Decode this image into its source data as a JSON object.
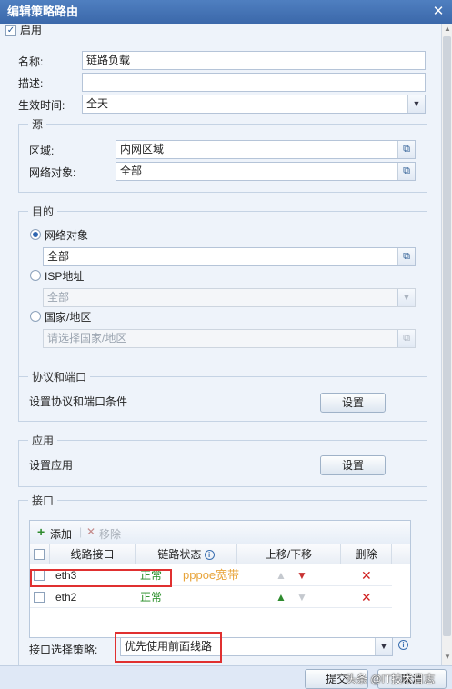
{
  "window": {
    "title": "编辑策略路由",
    "close_glyph": "✕"
  },
  "enable": {
    "label": "启用",
    "checked": true
  },
  "fields": {
    "name_label": "名称:",
    "name_value": "链路负载",
    "desc_label": "描述:",
    "desc_value": "",
    "time_label": "生效时间:",
    "time_value": "全天"
  },
  "source": {
    "legend": "源",
    "zone_label": "区域:",
    "zone_value": "内网区域",
    "net_label": "网络对象:",
    "net_value": "全部"
  },
  "dest": {
    "legend": "目的",
    "opt_net_label": "网络对象",
    "opt_net_value": "全部",
    "opt_isp_label": "ISP地址",
    "opt_isp_value": "全部",
    "opt_country_label": "国家/地区",
    "opt_country_placeholder": "请选择国家/地区",
    "selected": "网络对象"
  },
  "proto": {
    "legend": "协议和端口",
    "desc": "设置协议和端口条件",
    "button": "设置"
  },
  "app": {
    "legend": "应用",
    "desc": "设置应用",
    "button": "设置"
  },
  "iface": {
    "legend": "接口",
    "add": "添加",
    "remove": "移除",
    "columns": {
      "iface": "线路接口",
      "status": "链路状态",
      "move": "上移/下移",
      "delete": "删除"
    },
    "rows": [
      {
        "name": "eth3",
        "status": "正常"
      },
      {
        "name": "eth2",
        "status": "正常"
      }
    ],
    "annotation": "pppoe宽带",
    "policy_label": "接口选择策略:",
    "policy_value": "优先使用前面线路"
  },
  "footer": {
    "submit": "提交",
    "cancel": "取消",
    "watermark": "头条 @IT技术日志"
  },
  "colors": {
    "title_bar": "#3b68aa",
    "highlight": "#e03030",
    "status_ok": "#1f8a1f",
    "annotation": "#e8a43a"
  },
  "icons": {
    "picker": "picker-icon",
    "dropdown": "chevron-down-icon",
    "add": "plus-icon",
    "remove": "x-icon",
    "info": "info-icon",
    "up": "arrow-up-icon",
    "down": "arrow-down-icon",
    "delete": "delete-icon"
  }
}
